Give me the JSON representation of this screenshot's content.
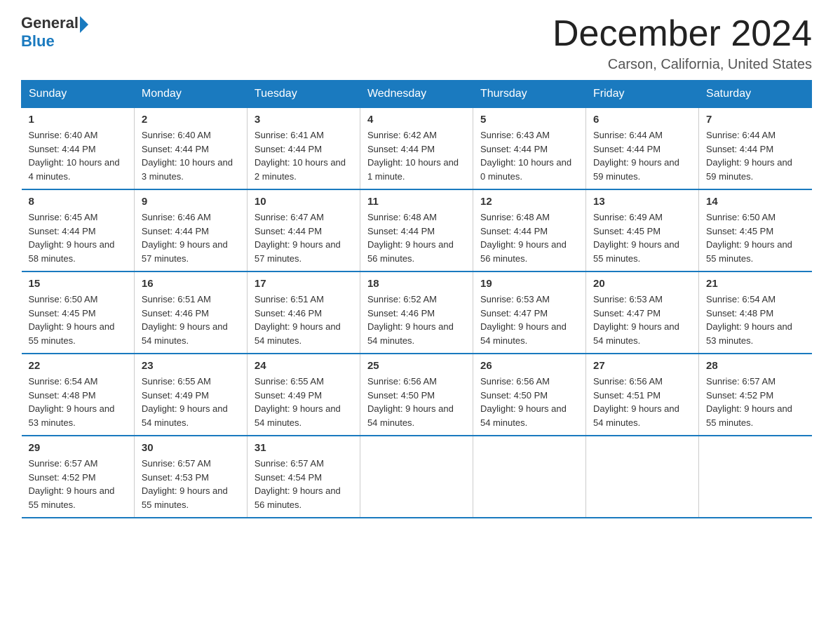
{
  "logo": {
    "general": "General",
    "blue": "Blue"
  },
  "title": "December 2024",
  "location": "Carson, California, United States",
  "days_of_week": [
    "Sunday",
    "Monday",
    "Tuesday",
    "Wednesday",
    "Thursday",
    "Friday",
    "Saturday"
  ],
  "weeks": [
    [
      {
        "day": "1",
        "sunrise": "6:40 AM",
        "sunset": "4:44 PM",
        "daylight": "10 hours and 4 minutes."
      },
      {
        "day": "2",
        "sunrise": "6:40 AM",
        "sunset": "4:44 PM",
        "daylight": "10 hours and 3 minutes."
      },
      {
        "day": "3",
        "sunrise": "6:41 AM",
        "sunset": "4:44 PM",
        "daylight": "10 hours and 2 minutes."
      },
      {
        "day": "4",
        "sunrise": "6:42 AM",
        "sunset": "4:44 PM",
        "daylight": "10 hours and 1 minute."
      },
      {
        "day": "5",
        "sunrise": "6:43 AM",
        "sunset": "4:44 PM",
        "daylight": "10 hours and 0 minutes."
      },
      {
        "day": "6",
        "sunrise": "6:44 AM",
        "sunset": "4:44 PM",
        "daylight": "9 hours and 59 minutes."
      },
      {
        "day": "7",
        "sunrise": "6:44 AM",
        "sunset": "4:44 PM",
        "daylight": "9 hours and 59 minutes."
      }
    ],
    [
      {
        "day": "8",
        "sunrise": "6:45 AM",
        "sunset": "4:44 PM",
        "daylight": "9 hours and 58 minutes."
      },
      {
        "day": "9",
        "sunrise": "6:46 AM",
        "sunset": "4:44 PM",
        "daylight": "9 hours and 57 minutes."
      },
      {
        "day": "10",
        "sunrise": "6:47 AM",
        "sunset": "4:44 PM",
        "daylight": "9 hours and 57 minutes."
      },
      {
        "day": "11",
        "sunrise": "6:48 AM",
        "sunset": "4:44 PM",
        "daylight": "9 hours and 56 minutes."
      },
      {
        "day": "12",
        "sunrise": "6:48 AM",
        "sunset": "4:44 PM",
        "daylight": "9 hours and 56 minutes."
      },
      {
        "day": "13",
        "sunrise": "6:49 AM",
        "sunset": "4:45 PM",
        "daylight": "9 hours and 55 minutes."
      },
      {
        "day": "14",
        "sunrise": "6:50 AM",
        "sunset": "4:45 PM",
        "daylight": "9 hours and 55 minutes."
      }
    ],
    [
      {
        "day": "15",
        "sunrise": "6:50 AM",
        "sunset": "4:45 PM",
        "daylight": "9 hours and 55 minutes."
      },
      {
        "day": "16",
        "sunrise": "6:51 AM",
        "sunset": "4:46 PM",
        "daylight": "9 hours and 54 minutes."
      },
      {
        "day": "17",
        "sunrise": "6:51 AM",
        "sunset": "4:46 PM",
        "daylight": "9 hours and 54 minutes."
      },
      {
        "day": "18",
        "sunrise": "6:52 AM",
        "sunset": "4:46 PM",
        "daylight": "9 hours and 54 minutes."
      },
      {
        "day": "19",
        "sunrise": "6:53 AM",
        "sunset": "4:47 PM",
        "daylight": "9 hours and 54 minutes."
      },
      {
        "day": "20",
        "sunrise": "6:53 AM",
        "sunset": "4:47 PM",
        "daylight": "9 hours and 54 minutes."
      },
      {
        "day": "21",
        "sunrise": "6:54 AM",
        "sunset": "4:48 PM",
        "daylight": "9 hours and 53 minutes."
      }
    ],
    [
      {
        "day": "22",
        "sunrise": "6:54 AM",
        "sunset": "4:48 PM",
        "daylight": "9 hours and 53 minutes."
      },
      {
        "day": "23",
        "sunrise": "6:55 AM",
        "sunset": "4:49 PM",
        "daylight": "9 hours and 54 minutes."
      },
      {
        "day": "24",
        "sunrise": "6:55 AM",
        "sunset": "4:49 PM",
        "daylight": "9 hours and 54 minutes."
      },
      {
        "day": "25",
        "sunrise": "6:56 AM",
        "sunset": "4:50 PM",
        "daylight": "9 hours and 54 minutes."
      },
      {
        "day": "26",
        "sunrise": "6:56 AM",
        "sunset": "4:50 PM",
        "daylight": "9 hours and 54 minutes."
      },
      {
        "day": "27",
        "sunrise": "6:56 AM",
        "sunset": "4:51 PM",
        "daylight": "9 hours and 54 minutes."
      },
      {
        "day": "28",
        "sunrise": "6:57 AM",
        "sunset": "4:52 PM",
        "daylight": "9 hours and 55 minutes."
      }
    ],
    [
      {
        "day": "29",
        "sunrise": "6:57 AM",
        "sunset": "4:52 PM",
        "daylight": "9 hours and 55 minutes."
      },
      {
        "day": "30",
        "sunrise": "6:57 AM",
        "sunset": "4:53 PM",
        "daylight": "9 hours and 55 minutes."
      },
      {
        "day": "31",
        "sunrise": "6:57 AM",
        "sunset": "4:54 PM",
        "daylight": "9 hours and 56 minutes."
      },
      null,
      null,
      null,
      null
    ]
  ],
  "labels": {
    "sunrise": "Sunrise:",
    "sunset": "Sunset:",
    "daylight": "Daylight:"
  }
}
